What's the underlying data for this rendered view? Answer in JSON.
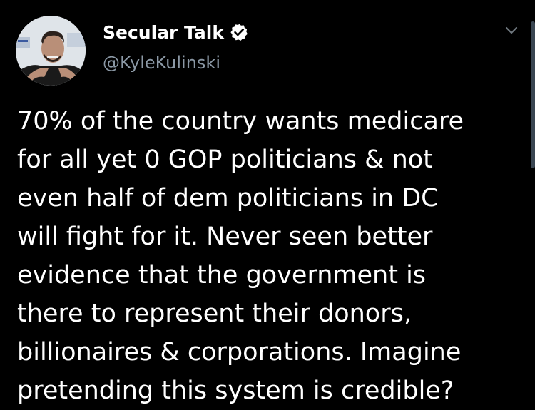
{
  "author": {
    "display_name": "Secular Talk",
    "handle": "@KyleKulinski",
    "verified": true
  },
  "icons": {
    "verified": "verified-badge-icon",
    "menu": "chevron-down-icon"
  },
  "tweet": {
    "lines": [
      "70% of the country wants medicare",
      "for all yet 0 GOP politicians & not",
      "even half of dem politicians in DC",
      "will fight for it. Never seen better",
      "evidence that the government is",
      "there to represent their donors,",
      "billionaires & corporations. Imagine",
      "pretending this system is credible?"
    ]
  },
  "colors": {
    "background": "#000000",
    "text": "#ffffff",
    "secondary_text": "#8b98a5",
    "icon": "#ffffff",
    "scrollbar": "#3a4652"
  }
}
